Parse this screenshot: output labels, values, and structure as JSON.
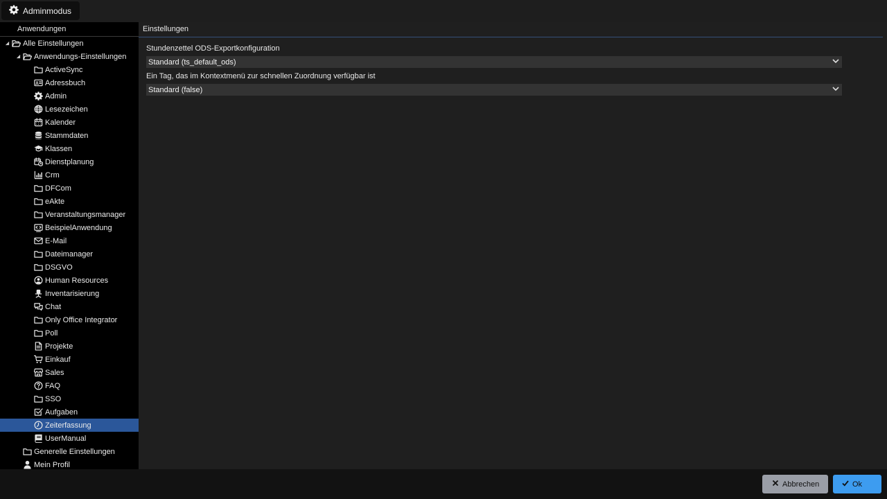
{
  "topbar": {
    "admin_label": "Adminmodus"
  },
  "sidebar": {
    "header": "Anwendungen",
    "items": [
      {
        "label": "Alle Einstellungen",
        "icon": "folder-open-icon",
        "level": 0,
        "expanded": true
      },
      {
        "label": "Anwendungs-Einstellungen",
        "icon": "folder-open-icon",
        "level": 1,
        "expanded": true
      },
      {
        "label": "ActiveSync",
        "icon": "folder-icon",
        "level": 2
      },
      {
        "label": "Adressbuch",
        "icon": "address-card-icon",
        "level": 2
      },
      {
        "label": "Admin",
        "icon": "gear-icon",
        "level": 2
      },
      {
        "label": "Lesezeichen",
        "icon": "globe-icon",
        "level": 2
      },
      {
        "label": "Kalender",
        "icon": "calendar-icon",
        "level": 2
      },
      {
        "label": "Stammdaten",
        "icon": "database-icon",
        "level": 2
      },
      {
        "label": "Klassen",
        "icon": "graduation-cap-icon",
        "level": 2
      },
      {
        "label": "Dienstplanung",
        "icon": "calendar-clock-icon",
        "level": 2
      },
      {
        "label": "Crm",
        "icon": "bar-chart-icon",
        "level": 2
      },
      {
        "label": "DFCom",
        "icon": "folder-icon",
        "level": 2
      },
      {
        "label": "eAkte",
        "icon": "folder-icon",
        "level": 2
      },
      {
        "label": "Veranstaltungsmanager",
        "icon": "folder-icon",
        "level": 2
      },
      {
        "label": "BeispielAnwendung",
        "icon": "code-window-icon",
        "level": 2
      },
      {
        "label": "E-Mail",
        "icon": "envelope-icon",
        "level": 2
      },
      {
        "label": "Dateimanager",
        "icon": "folder-icon",
        "level": 2
      },
      {
        "label": "DSGVO",
        "icon": "folder-icon",
        "level": 2
      },
      {
        "label": "Human Resources",
        "icon": "user-circle-icon",
        "level": 2
      },
      {
        "label": "Inventarisierung",
        "icon": "office-chair-icon",
        "level": 2
      },
      {
        "label": "Chat",
        "icon": "chat-icon",
        "level": 2
      },
      {
        "label": "Only Office Integrator",
        "icon": "folder-icon",
        "level": 2
      },
      {
        "label": "Poll",
        "icon": "folder-icon",
        "level": 2
      },
      {
        "label": "Projekte",
        "icon": "document-icon",
        "level": 2
      },
      {
        "label": "Einkauf",
        "icon": "cart-icon",
        "level": 2
      },
      {
        "label": "Sales",
        "icon": "store-icon",
        "level": 2
      },
      {
        "label": "FAQ",
        "icon": "question-circle-icon",
        "level": 2
      },
      {
        "label": "SSO",
        "icon": "folder-icon",
        "level": 2
      },
      {
        "label": "Aufgaben",
        "icon": "checkbox-icon",
        "level": 2
      },
      {
        "label": "Zeiterfassung",
        "icon": "clock-icon",
        "level": 2,
        "selected": true
      },
      {
        "label": "UserManual",
        "icon": "book-icon",
        "level": 2
      },
      {
        "label": "Generelle Einstellungen",
        "icon": "folder-icon",
        "level": 1
      },
      {
        "label": "Mein Profil",
        "icon": "user-icon",
        "level": 1
      }
    ]
  },
  "main": {
    "title": "Einstellungen",
    "fields": [
      {
        "label": "Stundenzettel ODS-Exportkonfiguration",
        "value": "Standard (ts_default_ods)"
      },
      {
        "label": "Ein Tag, das im Kontextmenü zur schnellen Zuordnung verfügbar ist",
        "value": "Standard (false)"
      }
    ]
  },
  "footer": {
    "cancel_label": "Abbrechen",
    "ok_label": "Ok"
  },
  "colors": {
    "selection": "#2b579a",
    "ok_button": "#3d9cf0",
    "cancel_button": "#9a9ea7"
  }
}
